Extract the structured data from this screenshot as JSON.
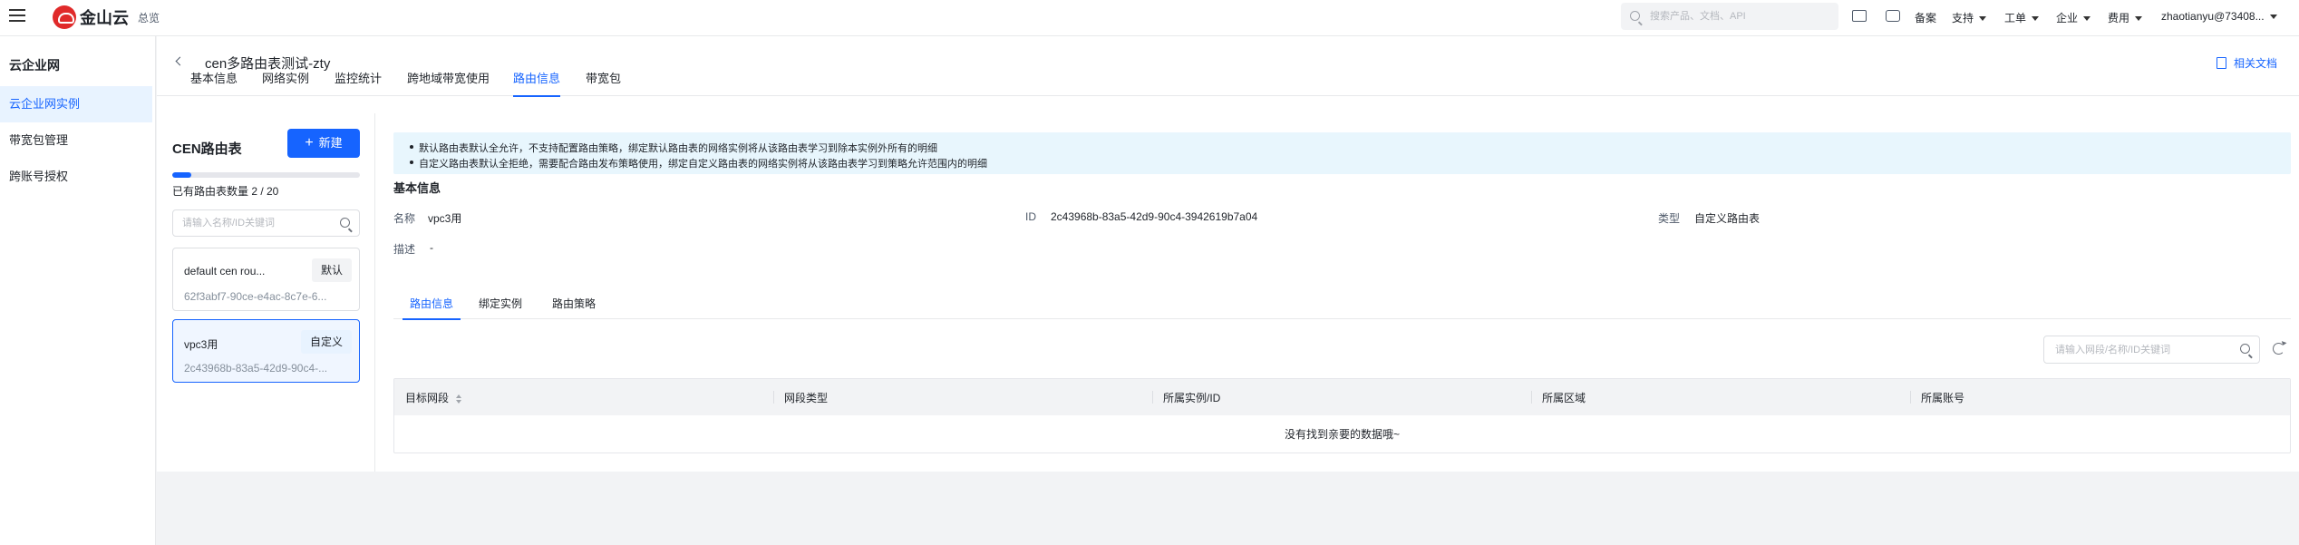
{
  "topbar": {
    "logo_text": "金山云",
    "overview": "总览",
    "search_placeholder": "搜索产品、文档、API",
    "links": {
      "beian": "备案",
      "support": "支持",
      "ticket": "工单",
      "enterprise": "企业",
      "billing": "费用",
      "user": "zhaotianyu@73408..."
    }
  },
  "sidebar": {
    "title": "云企业网",
    "items": [
      {
        "label": "云企业网实例",
        "active": true
      },
      {
        "label": "带宽包管理",
        "active": false
      },
      {
        "label": "跨账号授权",
        "active": false
      }
    ]
  },
  "page": {
    "title": "cen多路由表测试-zty",
    "doc_link": "相关文档",
    "tabs": [
      {
        "label": "基本信息",
        "active": false
      },
      {
        "label": "网络实例",
        "active": false
      },
      {
        "label": "监控统计",
        "active": false
      },
      {
        "label": "跨地域带宽使用",
        "active": false
      },
      {
        "label": "路由信息",
        "active": true
      },
      {
        "label": "带宽包",
        "active": false
      }
    ]
  },
  "route_panel": {
    "title": "CEN路由表",
    "new_button": "新建",
    "usage_fraction": 0.1,
    "count_text": "已有路由表数量 2 / 20",
    "search_placeholder": "请输入名称/ID关键词",
    "tables": [
      {
        "name": "default cen rou...",
        "tag": "默认",
        "id": "62f3abf7-90ce-e4ac-8c7e-6...",
        "selected": false
      },
      {
        "name": "vpc3用",
        "tag": "自定义",
        "id": "2c43968b-83a5-42d9-90c4-...",
        "selected": true
      }
    ]
  },
  "detail": {
    "notices": [
      "默认路由表默认全允许，不支持配置路由策略，绑定默认路由表的网络实例将从该路由表学习到除本实例外所有的明细",
      "自定义路由表默认全拒绝，需要配合路由发布策略使用，绑定自定义路由表的网络实例将从该路由表学习到策略允许范围内的明细"
    ],
    "section_title": "基本信息",
    "name_label": "名称",
    "name_value": "vpc3用",
    "id_label": "ID",
    "id_value": "2c43968b-83a5-42d9-90c4-3942619b7a04",
    "type_label": "类型",
    "type_value": "自定义路由表",
    "desc_label": "描述",
    "desc_value": "-",
    "subtabs": [
      {
        "label": "路由信息",
        "active": true
      },
      {
        "label": "绑定实例",
        "active": false
      },
      {
        "label": "路由策略",
        "active": false
      }
    ],
    "table_search_placeholder": "请输入网段/名称/ID关键词",
    "columns": [
      "目标网段",
      "网段类型",
      "所属实例/ID",
      "所属区域",
      "所属账号"
    ],
    "empty_text": "没有找到亲要的数据哦~"
  }
}
